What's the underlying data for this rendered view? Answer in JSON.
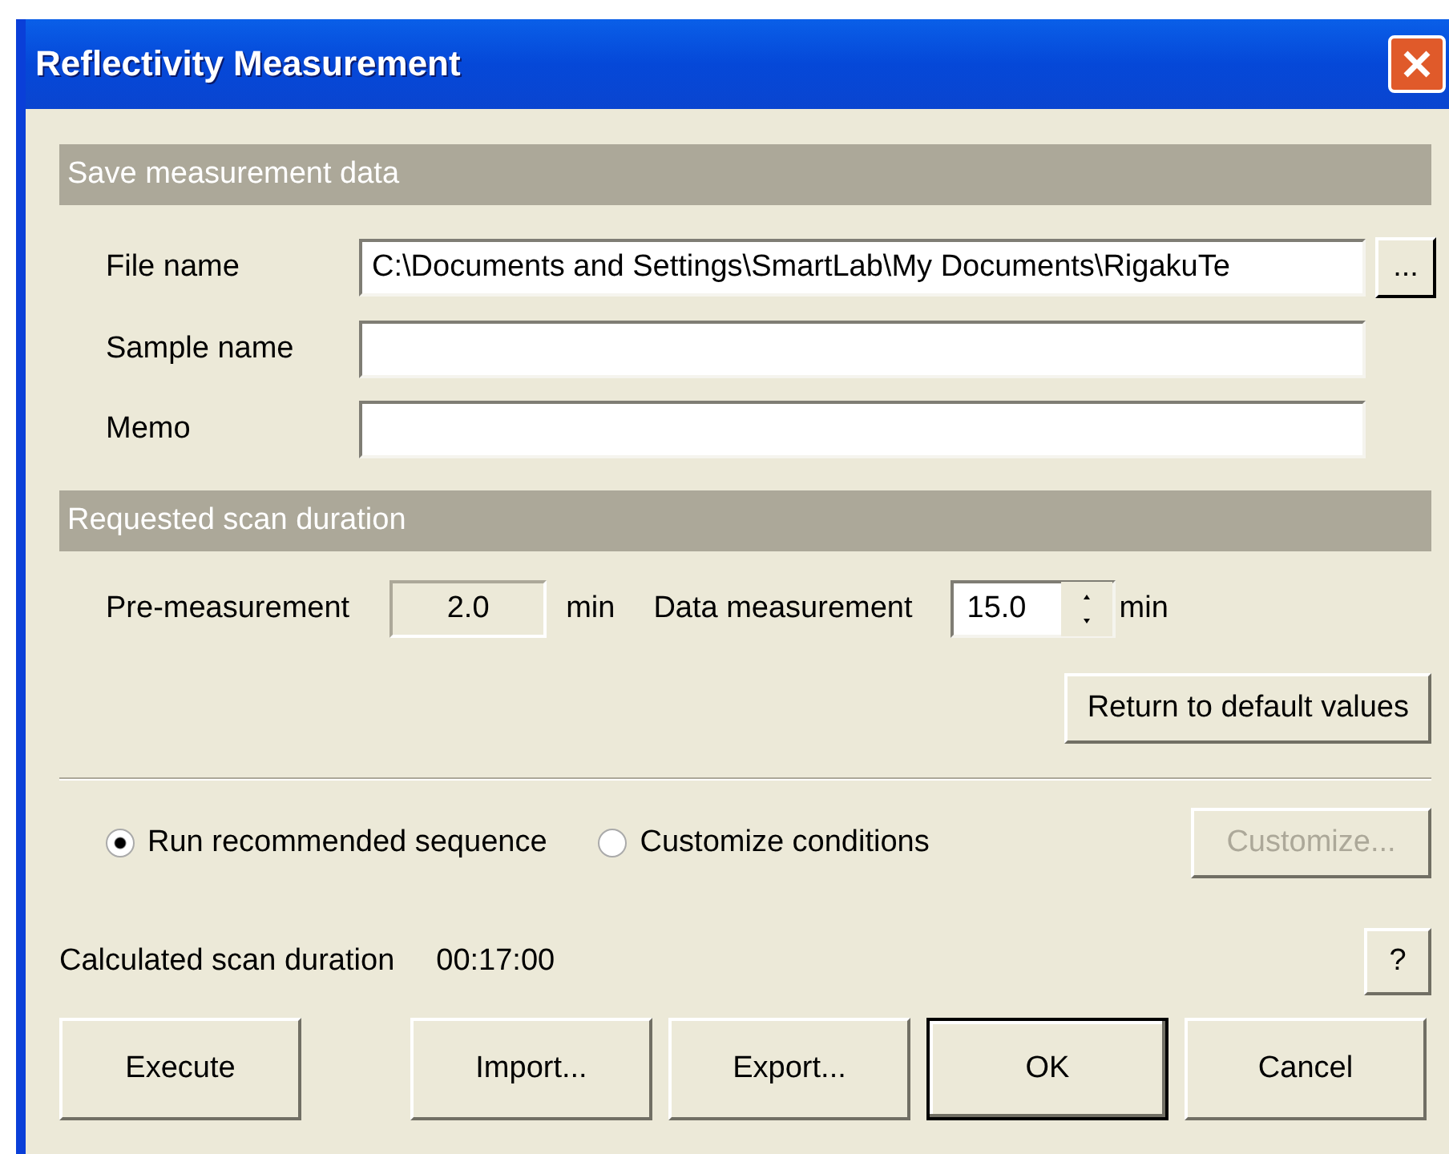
{
  "window": {
    "title": "Reflectivity Measurement"
  },
  "save_section": {
    "title": "Save measurement data",
    "fields": [
      {
        "label": "File name",
        "value": "C:\\Documents and Settings\\SmartLab\\My Documents\\RigakuTe",
        "browse": "..."
      },
      {
        "label": "Sample name"
      },
      {
        "label": "Memo"
      }
    ]
  },
  "duration_section": {
    "title": "Requested scan duration",
    "pre": {
      "label": "Pre-measurement",
      "value": "2.0",
      "disabled": true,
      "unit": "min"
    },
    "data": {
      "label": "Data measurement",
      "value": "15.0",
      "unit": "min"
    },
    "reset_button": "Return to default values"
  },
  "options": [
    {
      "label": "Run recommended sequence",
      "selected": true
    },
    {
      "label": "Customize conditions",
      "selected": false
    }
  ],
  "customize_button": {
    "label": "Customize...",
    "disabled": true
  },
  "calculated": {
    "label": "Calculated scan duration",
    "value": "00:17:00"
  },
  "help_button": "?",
  "buttons": [
    {
      "label": "Execute",
      "default": false
    },
    {
      "label": "Import...",
      "default": false
    },
    {
      "label": "Export...",
      "default": false
    },
    {
      "label": "OK",
      "default": true
    },
    {
      "label": "Cancel",
      "default": false
    }
  ]
}
